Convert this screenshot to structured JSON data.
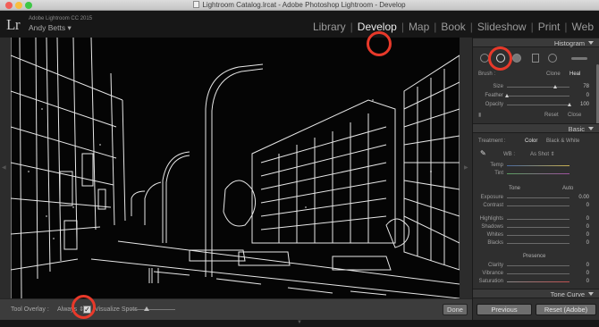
{
  "window": {
    "title": "Lightroom Catalog.lrcat - Adobe Photoshop Lightroom - Develop"
  },
  "identity": {
    "logo": "Lr",
    "app": "Adobe Lightroom CC 2015",
    "user": "Andy Betts",
    "user_menu": "▾"
  },
  "modules": [
    {
      "label": "Library",
      "active": false
    },
    {
      "label": "Develop",
      "active": true
    },
    {
      "label": "Map",
      "active": false
    },
    {
      "label": "Book",
      "active": false
    },
    {
      "label": "Slideshow",
      "active": false
    },
    {
      "label": "Print",
      "active": false
    },
    {
      "label": "Web",
      "active": false
    }
  ],
  "module_separator": "|",
  "toolbar": {
    "overlay_label": "Tool Overlay :",
    "overlay_value": "Always",
    "overlay_arrow": "⇕",
    "visualize_checked": "✓",
    "visualize_label": "Visualize Spots",
    "done": "Done"
  },
  "panel": {
    "histogram_title": "Histogram",
    "spot": {
      "brush_label": "Brush :",
      "clone": "Clone",
      "heal": "Heal",
      "size_label": "Size",
      "size_value": "78",
      "size_level": 0.78,
      "feather_label": "Feather",
      "feather_value": "0",
      "feather_level": 0.0,
      "opacity_label": "Opacity",
      "opacity_value": "100",
      "opacity_level": 1.0,
      "reset": "Reset",
      "close": "Close"
    },
    "basic": {
      "title": "Basic",
      "treatment_label": "Treatment :",
      "color": "Color",
      "bw": "Black & White",
      "wb_label": "WB :",
      "wb_value": "As Shot ⇕",
      "temp_label": "Temp",
      "tint_label": "Tint",
      "tone_label": "Tone",
      "auto": "Auto",
      "exposure_label": "Exposure",
      "exposure_value": "0.00",
      "contrast_label": "Contrast",
      "contrast_value": "0",
      "highlights_label": "Highlights",
      "highlights_value": "0",
      "shadows_label": "Shadows",
      "shadows_value": "0",
      "whites_label": "Whites",
      "whites_value": "0",
      "blacks_label": "Blacks",
      "blacks_value": "0",
      "presence_label": "Presence",
      "clarity_label": "Clarity",
      "clarity_value": "0",
      "vibrance_label": "Vibrance",
      "vibrance_value": "0",
      "saturation_label": "Saturation",
      "saturation_value": "0"
    },
    "tone_curve_title": "Tone Curve",
    "previous": "Previous",
    "reset_adobe": "Reset (Adobe)"
  },
  "colors": {
    "annotation": "#e8392a",
    "panel_bg": "#2f2f2f",
    "photo_lines": "#ffffff"
  }
}
